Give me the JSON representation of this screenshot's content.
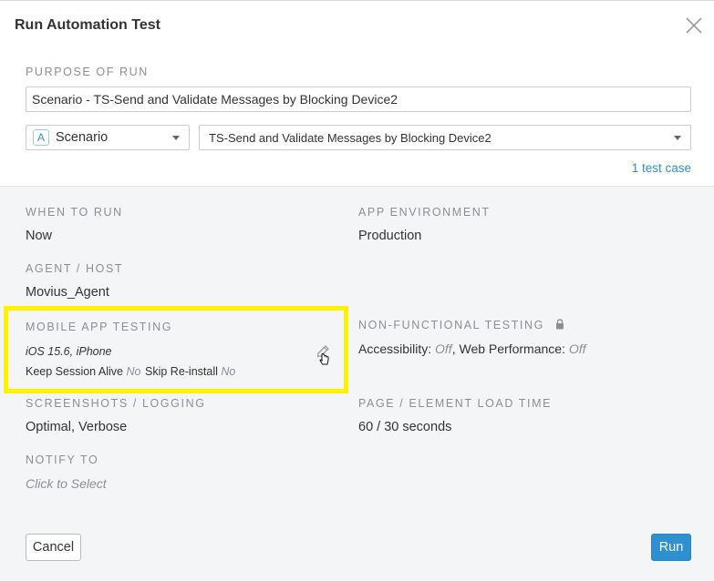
{
  "dialog": {
    "title": "Run Automation Test"
  },
  "purpose": {
    "label": "PURPOSE OF RUN",
    "value": "Scenario - TS-Send and Validate Messages by Blocking Device2"
  },
  "selectors": {
    "type_badge": "A",
    "type_value": "Scenario",
    "scenario_value": "TS-Send and Validate Messages by Blocking Device2",
    "test_case_link": "1 test case"
  },
  "settings": {
    "when_to_run": {
      "label": "WHEN TO RUN",
      "value": "Now"
    },
    "app_environment": {
      "label": "APP ENVIRONMENT",
      "value": "Production"
    },
    "agent_host": {
      "label": "AGENT / HOST",
      "value": "Movius_Agent"
    },
    "mobile_app_testing": {
      "label": "MOBILE APP TESTING",
      "device": "iOS 15.6, iPhone",
      "keep_session_label": "Keep Session Alive",
      "keep_session_value": "No",
      "skip_reinstall_label": "Skip Re-install",
      "skip_reinstall_value": "No"
    },
    "non_functional_testing": {
      "label": "NON-FUNCTIONAL TESTING",
      "accessibility_label": "Accessibility:",
      "accessibility_value": "Off",
      "separator": ",",
      "web_performance_label": "Web Performance:",
      "web_performance_value": "Off"
    },
    "screenshots_logging": {
      "label": "SCREENSHOTS / LOGGING",
      "value": "Optimal, Verbose"
    },
    "page_element_load_time": {
      "label": "PAGE / ELEMENT LOAD TIME",
      "value": "60 / 30 seconds"
    },
    "notify_to": {
      "label": "NOTIFY TO",
      "value": "Click to Select"
    }
  },
  "buttons": {
    "cancel": "Cancel",
    "run": "Run"
  },
  "colors": {
    "accent": "#2e8fd1",
    "highlight": "#fff200",
    "panel_bg": "#f4f5f7"
  },
  "icons": {
    "close": "close-icon",
    "caret": "caret-down-icon",
    "edit": "pencil-icon",
    "cursor": "hand-pointer-icon",
    "lock": "lock-icon"
  }
}
